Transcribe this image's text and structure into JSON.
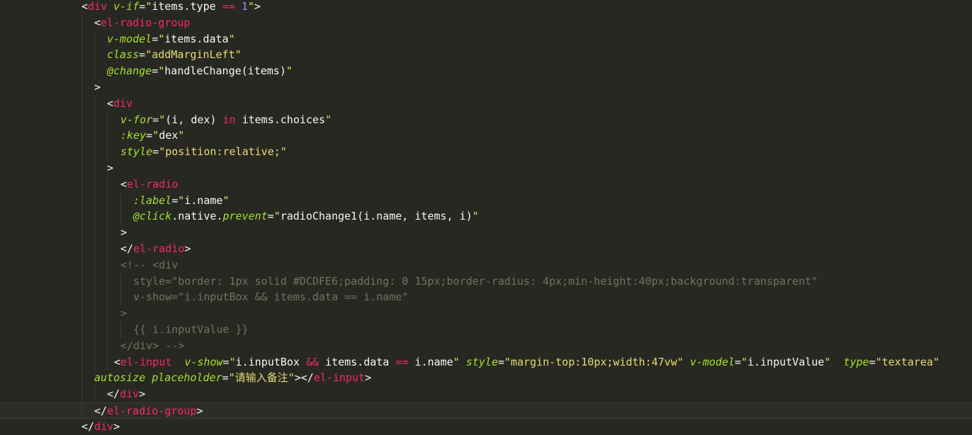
{
  "editor": {
    "lines": [
      {
        "indent": 115,
        "tokens": [
          [
            "p",
            "<"
          ],
          [
            "t",
            "div"
          ],
          [
            "p",
            " "
          ],
          [
            "a",
            "v-if"
          ],
          [
            "p",
            "="
          ],
          [
            "s",
            "\""
          ],
          [
            "p",
            "items.type "
          ],
          [
            "k",
            "=="
          ],
          [
            "p",
            " "
          ],
          [
            "n",
            "1"
          ],
          [
            "s",
            "\""
          ],
          [
            "p",
            ">"
          ]
        ]
      },
      {
        "indent": 133,
        "tokens": [
          [
            "p",
            "<"
          ],
          [
            "t",
            "el-radio-group"
          ]
        ]
      },
      {
        "indent": 151,
        "tokens": [
          [
            "a",
            "v-model"
          ],
          [
            "p",
            "="
          ],
          [
            "s",
            "\""
          ],
          [
            "p",
            "items.data"
          ],
          [
            "s",
            "\""
          ]
        ]
      },
      {
        "indent": 151,
        "tokens": [
          [
            "a",
            "class"
          ],
          [
            "p",
            "="
          ],
          [
            "s",
            "\"addMarginLeft\""
          ]
        ]
      },
      {
        "indent": 151,
        "tokens": [
          [
            "a",
            "@change"
          ],
          [
            "p",
            "="
          ],
          [
            "s",
            "\""
          ],
          [
            "p",
            "handleChange(items)"
          ],
          [
            "s",
            "\""
          ]
        ]
      },
      {
        "indent": 133,
        "tokens": [
          [
            "p",
            ">"
          ]
        ]
      },
      {
        "indent": 151,
        "tokens": [
          [
            "p",
            "<"
          ],
          [
            "t",
            "div"
          ]
        ]
      },
      {
        "indent": 170,
        "tokens": [
          [
            "a",
            "v-for"
          ],
          [
            "p",
            "="
          ],
          [
            "s",
            "\""
          ],
          [
            "p",
            "(i, dex) "
          ],
          [
            "k",
            "in"
          ],
          [
            "p",
            " items.choices"
          ],
          [
            "s",
            "\""
          ]
        ]
      },
      {
        "indent": 170,
        "tokens": [
          [
            "a",
            ":key"
          ],
          [
            "p",
            "="
          ],
          [
            "s",
            "\""
          ],
          [
            "p",
            "dex"
          ],
          [
            "s",
            "\""
          ]
        ]
      },
      {
        "indent": 170,
        "tokens": [
          [
            "a",
            "style"
          ],
          [
            "p",
            "="
          ],
          [
            "s",
            "\"position:relative;\""
          ]
        ]
      },
      {
        "indent": 151,
        "tokens": [
          [
            "p",
            ">"
          ]
        ]
      },
      {
        "indent": 170,
        "tokens": [
          [
            "p",
            "<"
          ],
          [
            "t",
            "el-radio"
          ]
        ]
      },
      {
        "indent": 188,
        "tokens": [
          [
            "a",
            ":label"
          ],
          [
            "p",
            "="
          ],
          [
            "s",
            "\""
          ],
          [
            "p",
            "i.name"
          ],
          [
            "s",
            "\""
          ]
        ]
      },
      {
        "indent": 188,
        "tokens": [
          [
            "a",
            "@click"
          ],
          [
            "p",
            ".native."
          ],
          [
            "a",
            "prevent"
          ],
          [
            "p",
            "="
          ],
          [
            "s",
            "\""
          ],
          [
            "p",
            "radioChange1(i.name, items, i)"
          ],
          [
            "s",
            "\""
          ]
        ]
      },
      {
        "indent": 170,
        "tokens": [
          [
            "p",
            ">"
          ]
        ]
      },
      {
        "indent": 170,
        "tokens": [
          [
            "p",
            "</"
          ],
          [
            "t",
            "el-radio"
          ],
          [
            "p",
            ">"
          ]
        ]
      },
      {
        "indent": 170,
        "tokens": [
          [
            "c",
            "<!-- <div"
          ]
        ]
      },
      {
        "indent": 188,
        "tokens": [
          [
            "c",
            "style=\"border: 1px solid #DCDFE6;padding: 0 15px;border-radius: 4px;min-height:40px;background:transparent\""
          ]
        ]
      },
      {
        "indent": 188,
        "tokens": [
          [
            "c",
            "v-show=\"i.inputBox && items.data == i.name\""
          ]
        ]
      },
      {
        "indent": 170,
        "tokens": [
          [
            "c",
            ">"
          ]
        ]
      },
      {
        "indent": 188,
        "tokens": [
          [
            "c",
            "{{ i.inputValue }}"
          ]
        ]
      },
      {
        "indent": 170,
        "tokens": [
          [
            "c",
            "</div> -->"
          ]
        ]
      },
      {
        "indent": 161,
        "tokens": [
          [
            "p",
            "<"
          ],
          [
            "t",
            "el-input"
          ],
          [
            "p",
            "  "
          ],
          [
            "a",
            "v-show"
          ],
          [
            "p",
            "="
          ],
          [
            "s",
            "\""
          ],
          [
            "p",
            "i.inputBox "
          ],
          [
            "k",
            "&&"
          ],
          [
            "p",
            " items.data "
          ],
          [
            "k",
            "=="
          ],
          [
            "p",
            " i.name"
          ],
          [
            "s",
            "\""
          ],
          [
            "p",
            " "
          ],
          [
            "a",
            "style"
          ],
          [
            "p",
            "="
          ],
          [
            "s",
            "\"margin-top:10px;width:47vw\""
          ],
          [
            "p",
            " "
          ],
          [
            "a",
            "v-model"
          ],
          [
            "p",
            "="
          ],
          [
            "s",
            "\""
          ],
          [
            "p",
            "i.inputValue"
          ],
          [
            "s",
            "\""
          ],
          [
            "p",
            "  "
          ],
          [
            "a",
            "type"
          ],
          [
            "p",
            "="
          ],
          [
            "s",
            "\"textarea\""
          ]
        ]
      },
      {
        "indent": 133,
        "tokens": [
          [
            "a",
            "autosize"
          ],
          [
            "p",
            " "
          ],
          [
            "a",
            "placeholder"
          ],
          [
            "p",
            "="
          ],
          [
            "s",
            "\"请输入备注\""
          ],
          [
            "p",
            "></"
          ],
          [
            "t",
            "el-input"
          ],
          [
            "p",
            ">"
          ]
        ]
      },
      {
        "indent": 151,
        "tokens": [
          [
            "p",
            "</"
          ],
          [
            "t",
            "div"
          ],
          [
            "p",
            ">"
          ]
        ]
      },
      {
        "indent": 133,
        "current": true,
        "tokens": [
          [
            "p",
            "</"
          ],
          [
            "t",
            "el-radio-group"
          ],
          [
            "p",
            ">"
          ]
        ]
      },
      {
        "indent": 115,
        "tokens": [
          [
            "p",
            "</"
          ],
          [
            "t",
            "div"
          ],
          [
            "p",
            ">"
          ]
        ]
      }
    ]
  }
}
